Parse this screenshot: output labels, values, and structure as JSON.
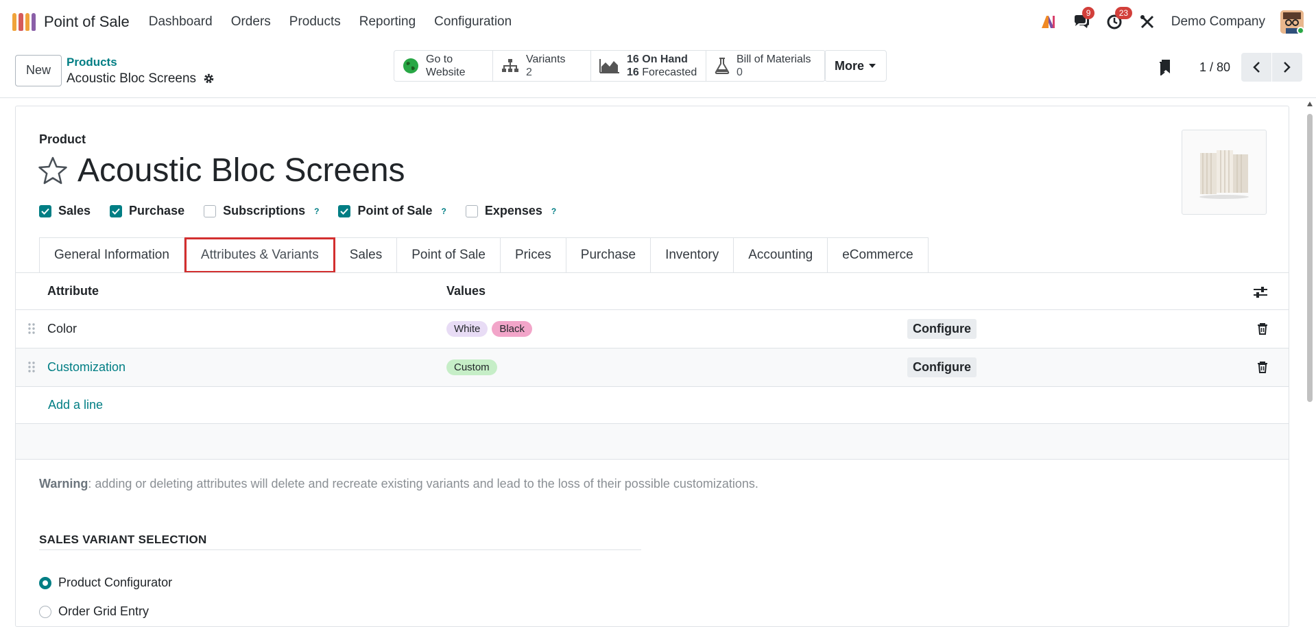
{
  "app": {
    "name": "Point of Sale"
  },
  "menu": [
    "Dashboard",
    "Orders",
    "Products",
    "Reporting",
    "Configuration"
  ],
  "systray": {
    "messages_count": "9",
    "activities_count": "23",
    "company": "Demo Company"
  },
  "control": {
    "new_label": "New",
    "breadcrumb_parent": "Products",
    "breadcrumb_current": "Acoustic Bloc Screens",
    "smart_buttons": {
      "website_line1": "Go to",
      "website_line2": "Website",
      "variants_label": "Variants",
      "variants_count": "2",
      "on_hand": "16 On Hand",
      "forecasted_num": "16",
      "forecasted_label": "Forecasted",
      "bom_label": "Bill of Materials",
      "bom_count": "0"
    },
    "more_label": "More",
    "pager": "1 / 80"
  },
  "form": {
    "product_label": "Product",
    "product_name": "Acoustic Bloc Screens",
    "checkboxes": [
      {
        "label": "Sales",
        "checked": true
      },
      {
        "label": "Purchase",
        "checked": true
      },
      {
        "label": "Subscriptions",
        "checked": false
      },
      {
        "label": "Point of Sale",
        "checked": true
      },
      {
        "label": "Expenses",
        "checked": false
      }
    ],
    "help_mark": "?",
    "tabs": [
      "General Information",
      "Attributes & Variants",
      "Sales",
      "Point of Sale",
      "Prices",
      "Purchase",
      "Inventory",
      "Accounting",
      "eCommerce"
    ],
    "active_tab": "Attributes & Variants",
    "table": {
      "col_attribute": "Attribute",
      "col_values": "Values",
      "rows": [
        {
          "attribute": "Color",
          "values": [
            "White",
            "Black"
          ],
          "configure": "Configure"
        },
        {
          "attribute": "Customization",
          "values": [
            "Custom"
          ],
          "configure": "Configure"
        }
      ],
      "add_line": "Add a line"
    },
    "warning_bold": "Warning",
    "warning_text": ": adding or deleting attributes will delete and recreate existing variants and lead to the loss of their possible customizations.",
    "section_title": "SALES VARIANT SELECTION",
    "radio_options": [
      {
        "label": "Product Configurator",
        "selected": true
      },
      {
        "label": "Order Grid Entry",
        "selected": false
      }
    ]
  },
  "colors": {
    "accent": "#017e84",
    "highlight_box": "#d32f2f",
    "tag_white": "#e8dcf5",
    "tag_black": "#f2a5c9",
    "tag_custom": "#c6eec7"
  }
}
